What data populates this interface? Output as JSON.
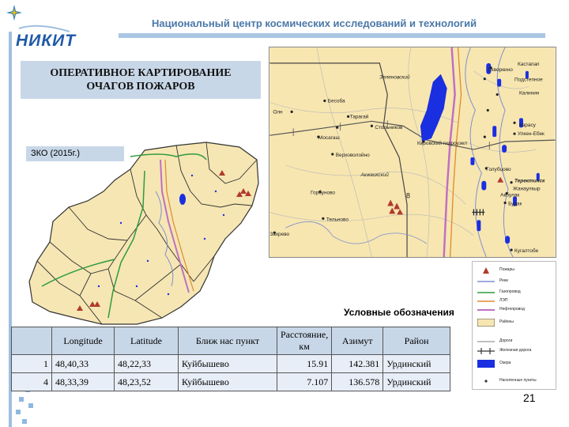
{
  "header": {
    "logo_text": "НИКИТ",
    "title": "Национальный центр космических исследований и технологий"
  },
  "slide": {
    "title_line1": "ОПЕРАТИВНОЕ КАРТИРОВАНИЕ",
    "title_line2": "ОЧАГОВ ПОЖАРОВ",
    "region_label": "ЗКО (2015г.)",
    "legend_heading": "Условные обозначения",
    "page_number": "21"
  },
  "map_labels": {
    "zelenovsky": "Зеленовский",
    "kastalap": "Кастапап",
    "skvorkino": "Скворкино",
    "podstepnoe": "Подстепное",
    "kalinin": "Калинин",
    "besoba": "Бесоба",
    "oly": "Олн",
    "taragai": "Тарагай",
    "stolbnikov": "Стольников",
    "mosagash": "Мосагаш",
    "verkhovolojno": "Верховолойно",
    "kirovsky": "Кировский гидроузел",
    "karasu": "Карасу",
    "ulken_ebek": "Улкен-Ебек",
    "akzhaiksky": "Акжаикский",
    "terekty": "Теректинск",
    "gorbunovo": "Горбуново",
    "golubtsovo": "Голубцово",
    "akbulak": "Акбулак",
    "zhanaulkyr": "Жанаулкыр",
    "budak": "Будак",
    "telnovo": "Тельново",
    "kuibyshevo": "Куйбышево",
    "zhakhrevo": "Захрево",
    "kugaltobe": "Кугалтобе",
    "fire_number": "8"
  },
  "legend": [
    {
      "label": "Пожары",
      "symbol": "triangle",
      "color": "#b03a2e"
    },
    {
      "label": "Реки",
      "symbol": "line",
      "color": "#7f8fd0"
    },
    {
      "label": "Газопровод",
      "symbol": "line",
      "color": "#2e9b3e"
    },
    {
      "label": "ЛЭП",
      "symbol": "line",
      "color": "#e08a2a"
    },
    {
      "label": "Нефтепровод",
      "symbol": "line",
      "color": "#c070c0"
    },
    {
      "label": "Районы",
      "symbol": "box",
      "color": "#f7e6b0"
    },
    {
      "label": "Дороги",
      "symbol": "line",
      "color": "#999999"
    },
    {
      "label": "Железная дорога",
      "symbol": "rail",
      "color": "#333333"
    },
    {
      "label": "Озера",
      "symbol": "box",
      "color": "#1a2fe0"
    },
    {
      "label": "Населенные пункты",
      "symbol": "dot",
      "color": "#333333"
    }
  ],
  "table": {
    "headers": [
      "",
      "Longitude",
      "Latitude",
      "Ближ нас пункт",
      "Расстояние, км",
      "Азимут",
      "Район"
    ],
    "rows": [
      [
        "1",
        "48,40,33",
        "48,22,33",
        "Куйбышево",
        "15.91",
        "142.381",
        "Урдинский"
      ],
      [
        "4",
        "48,33,39",
        "48,23,52",
        "Куйбышево",
        "7.107",
        "136.578",
        "Урдинский"
      ]
    ]
  },
  "colors": {
    "accent_blue": "#4a78a8",
    "panel_blue": "#c8d7e8",
    "map_land": "#f7e6b0",
    "lake": "#1a2fe0",
    "fire": "#b03a2e"
  }
}
